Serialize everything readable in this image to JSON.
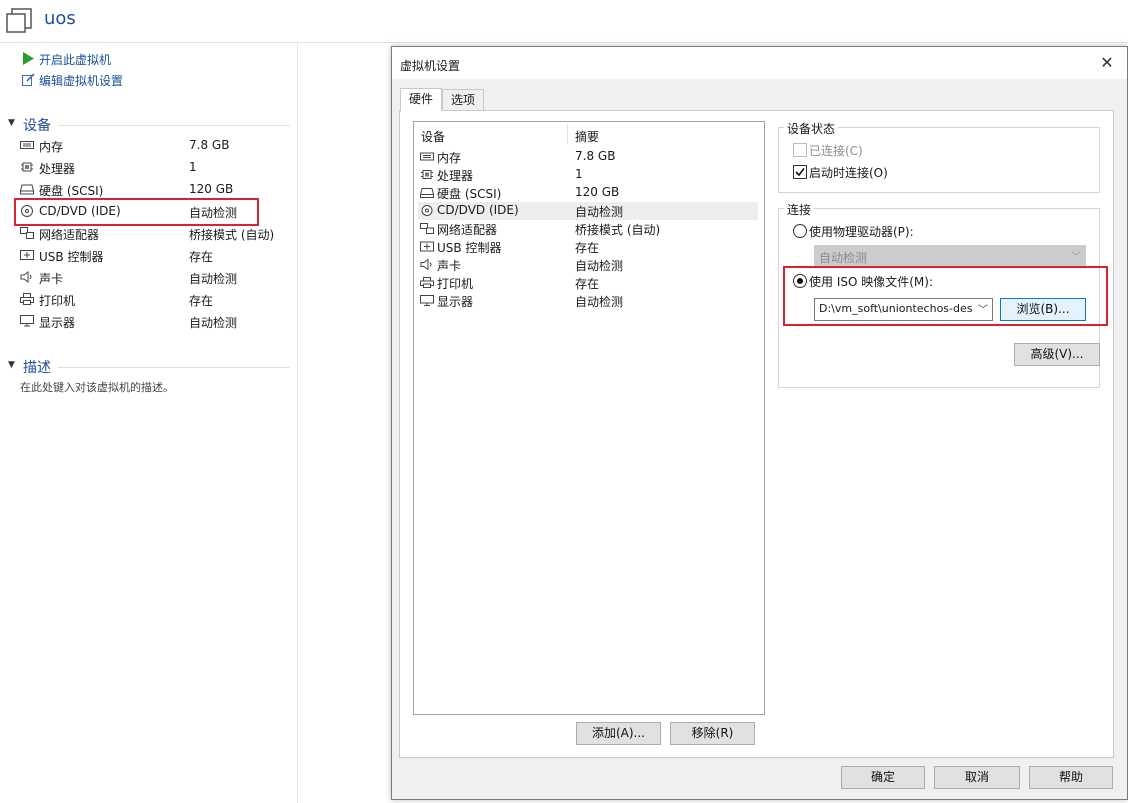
{
  "vm": {
    "title": "uos",
    "actions": {
      "power_on": "开启此虚拟机",
      "edit_settings": "编辑虚拟机设置"
    },
    "devices_section": "设备",
    "devices": [
      {
        "name": "内存",
        "value": "7.8 GB",
        "icon": "memory-icon"
      },
      {
        "name": "处理器",
        "value": "1",
        "icon": "processor-icon"
      },
      {
        "name": "硬盘 (SCSI)",
        "value": "120 GB",
        "icon": "harddisk-icon"
      },
      {
        "name": "CD/DVD (IDE)",
        "value": "自动检测",
        "icon": "cd-dvd-icon"
      },
      {
        "name": "网络适配器",
        "value": "桥接模式 (自动)",
        "icon": "network-icon"
      },
      {
        "name": "USB 控制器",
        "value": "存在",
        "icon": "usb-icon"
      },
      {
        "name": "声卡",
        "value": "自动检测",
        "icon": "sound-icon"
      },
      {
        "name": "打印机",
        "value": "存在",
        "icon": "printer-icon"
      },
      {
        "name": "显示器",
        "value": "自动检测",
        "icon": "display-icon"
      }
    ],
    "description_section": "描述",
    "description_placeholder": "在此处键入对该虚拟机的描述。"
  },
  "dialog": {
    "title": "虚拟机设置",
    "close": "✕",
    "tabs": [
      "硬件",
      "选项"
    ],
    "list_headers": {
      "device": "设备",
      "summary": "摘要"
    },
    "devices": [
      {
        "name": "内存",
        "value": "7.8 GB"
      },
      {
        "name": "处理器",
        "value": "1"
      },
      {
        "name": "硬盘 (SCSI)",
        "value": "120 GB"
      },
      {
        "name": "CD/DVD (IDE)",
        "value": "自动检测"
      },
      {
        "name": "网络适配器",
        "value": "桥接模式 (自动)"
      },
      {
        "name": "USB 控制器",
        "value": "存在"
      },
      {
        "name": "声卡",
        "value": "自动检测"
      },
      {
        "name": "打印机",
        "value": "存在"
      },
      {
        "name": "显示器",
        "value": "自动检测"
      }
    ],
    "selected_device": "CD/DVD (IDE)",
    "add_button": "添加(A)...",
    "remove_button": "移除(R)",
    "device_status": {
      "label": "设备状态",
      "connected": "已连接(C)",
      "connect_at_power_on": "启动时连接(O)"
    },
    "connection": {
      "label": "连接",
      "use_physical": "使用物理驱动器(P):",
      "physical_value": "自动检测",
      "use_iso": "使用 ISO 映像文件(M):",
      "iso_path": "D:\\vm_soft\\uniontechos-des",
      "browse": "浏览(B)..."
    },
    "advanced_button": "高级(V)...",
    "ok_button": "确定",
    "cancel_button": "取消",
    "help_button": "帮助"
  }
}
